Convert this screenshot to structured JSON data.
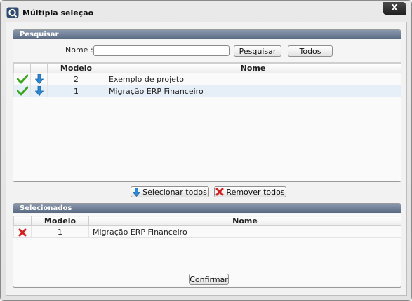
{
  "window": {
    "title": "Múltipla seleção",
    "close_label": "X"
  },
  "search": {
    "header": "Pesquisar",
    "name_label": "Nome :",
    "name_value": "",
    "search_button": "Pesquisar",
    "all_button": "Todos",
    "columns": [
      "Modelo",
      "Nome"
    ],
    "rows": [
      {
        "modelo": "2",
        "nome": "Exemplo de projeto"
      },
      {
        "modelo": "1",
        "nome": "Migração ERP Financeiro"
      }
    ]
  },
  "actions": {
    "select_all": "Selecionar todos",
    "remove_all": "Remover todos"
  },
  "selected": {
    "header": "Selecionados",
    "columns": [
      "Modelo",
      "Nome"
    ],
    "rows": [
      {
        "modelo": "1",
        "nome": "Migração ERP Financeiro"
      }
    ]
  },
  "confirm_label": "Confirmar",
  "colors": {
    "header": "#5a6a82",
    "check": "#3aa51e",
    "arrow": "#2a8ad8",
    "remove": "#d02020"
  }
}
